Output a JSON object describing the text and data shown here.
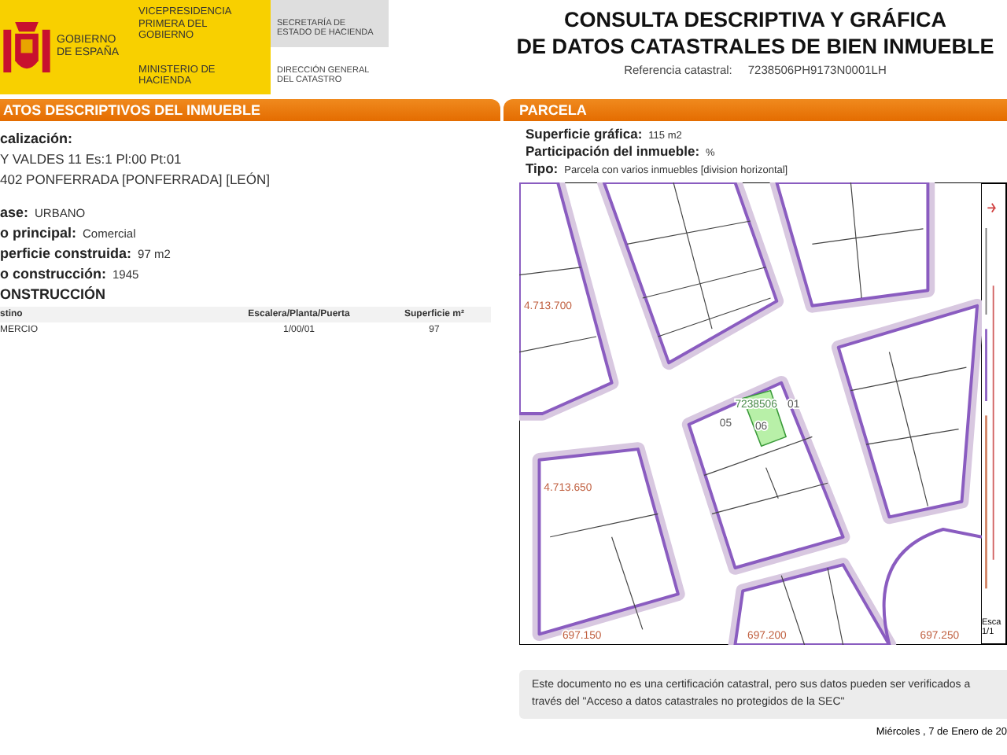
{
  "header": {
    "logo_text": "GOBIERNO DE ESPAÑA",
    "ministry_lines": [
      "VICEPRESIDENCIA PRIMERA DEL GOBIERNO",
      "MINISTERIO DE HACIENDA"
    ],
    "agency_lines": [
      "SECRETARÍA DE ESTADO DE HACIENDA",
      "DIRECCIÓN GENERAL DEL CATASTRO"
    ]
  },
  "title": {
    "lines": [
      "CONSULTA DESCRIPTIVA Y GRÁFICA",
      "DE DATOS CATASTRALES DE BIEN INMUEBLE"
    ],
    "reference_label": "Referencia catastral:",
    "reference_value": "7238506PH9173N0001LH"
  },
  "inmueble": {
    "heading": "ATOS DESCRIPTIVOS DEL INMUEBLE",
    "location_label": "calización:",
    "location_lines": [
      "Y VALDES 11 Es:1 Pl:00 Pt:01",
      "402 PONFERRADA [PONFERRADA] [LEÓN]"
    ],
    "fields": [
      {
        "label": "ase:",
        "value": "URBANO"
      },
      {
        "label": "o principal:",
        "value": "Comercial"
      },
      {
        "label": "perficie construida:",
        "value": "97 m2"
      },
      {
        "label": "o construcción:",
        "value": "1945"
      }
    ],
    "construction_heading": "ONSTRUCCIÓN",
    "table": {
      "columns": [
        "stino",
        "Escalera/Planta/Puerta",
        "Superficie m²"
      ],
      "rows": [
        [
          "MERCIO",
          "1/00/01",
          "97"
        ]
      ]
    }
  },
  "parcela": {
    "heading": "PARCELA",
    "fields": [
      {
        "label": "Superficie gráfica:",
        "value": "115 m2"
      },
      {
        "label": "Participación del inmueble:",
        "value": "%"
      },
      {
        "label": "Tipo:",
        "value": "Parcela con varios inmuebles [division horizontal]"
      }
    ],
    "map": {
      "labels": [
        "4.713.700",
        "4.713.650",
        "697.150",
        "697.200",
        "697.250",
        "7238506",
        "01",
        "05",
        "06"
      ],
      "scale_lines": [
        "Esca",
        "1/1"
      ]
    }
  },
  "note": "Este documento no es una certificación catastral, pero sus datos pueden ser verificados a través del \"Acceso a datos catastrales no protegidos de la SEC\"",
  "date": "Miércoles , 7 de Enero de 20"
}
